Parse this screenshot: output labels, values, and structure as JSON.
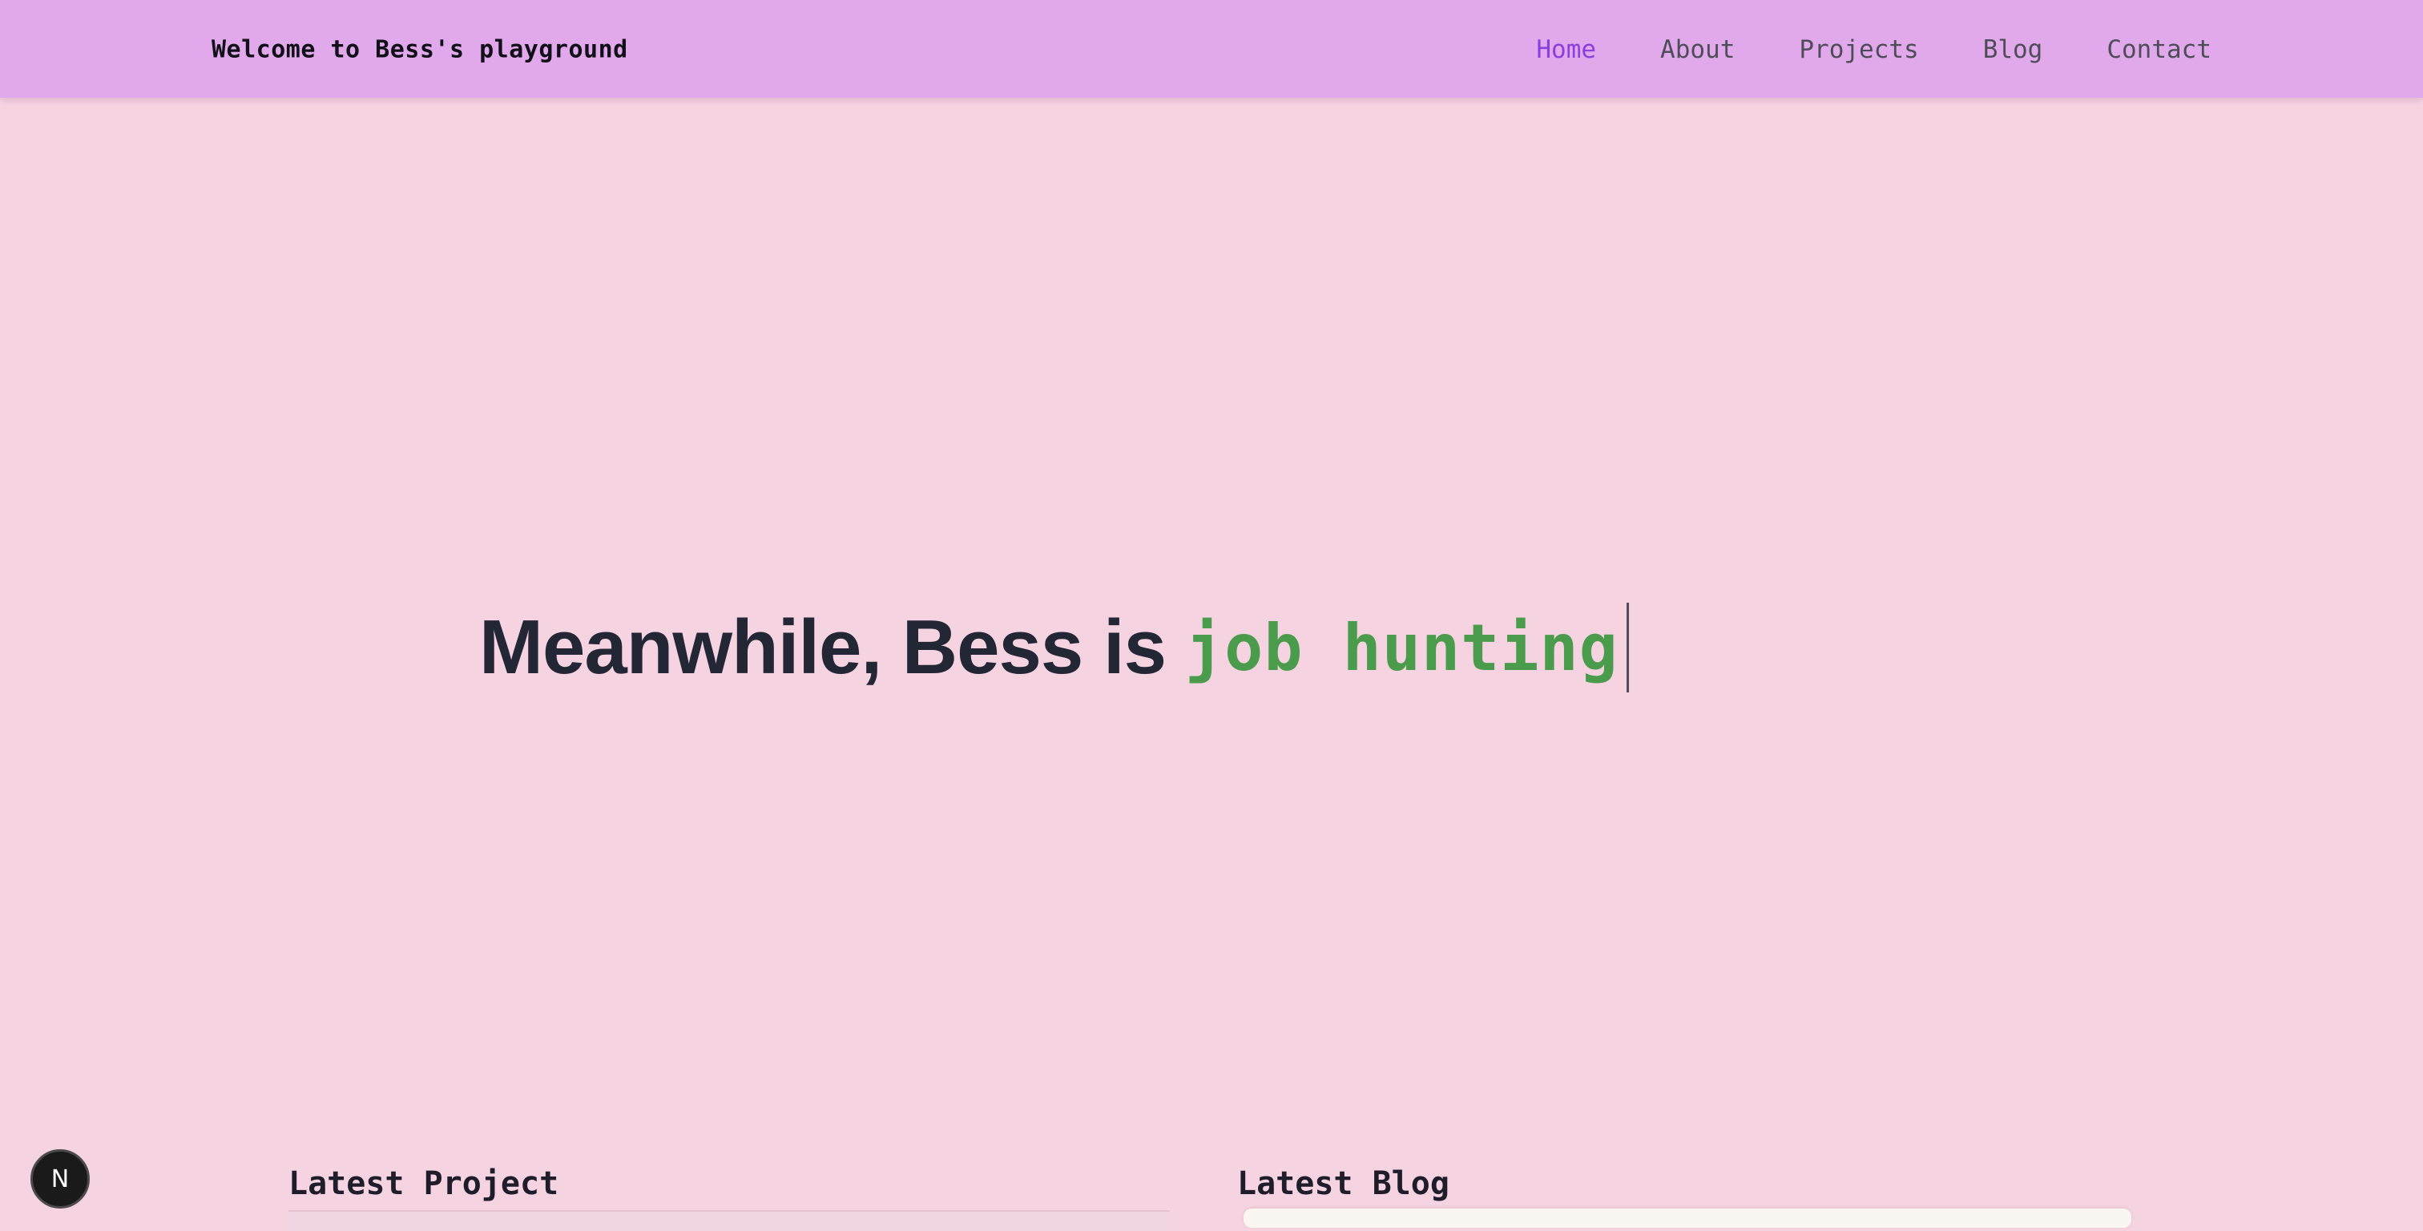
{
  "header": {
    "brand": "Welcome to Bess's playground",
    "nav": [
      {
        "label": "Home",
        "active": true
      },
      {
        "label": "About",
        "active": false
      },
      {
        "label": "Projects",
        "active": false
      },
      {
        "label": "Blog",
        "active": false
      },
      {
        "label": "Contact",
        "active": false
      }
    ]
  },
  "hero": {
    "prefix": "Meanwhile, Bess is",
    "typed_text": "job hunting"
  },
  "sections": {
    "latest_project_title": "Latest Project",
    "latest_blog_title": "Latest Blog"
  },
  "badge": {
    "letter": "N",
    "icon": "nextjs-logo-icon"
  },
  "colors": {
    "background": "#f5d3e1",
    "navbar": "#e1a9ec",
    "nav_active": "#8a3fdc",
    "typed_text": "#4a9c4c",
    "heading_text": "#232634"
  }
}
